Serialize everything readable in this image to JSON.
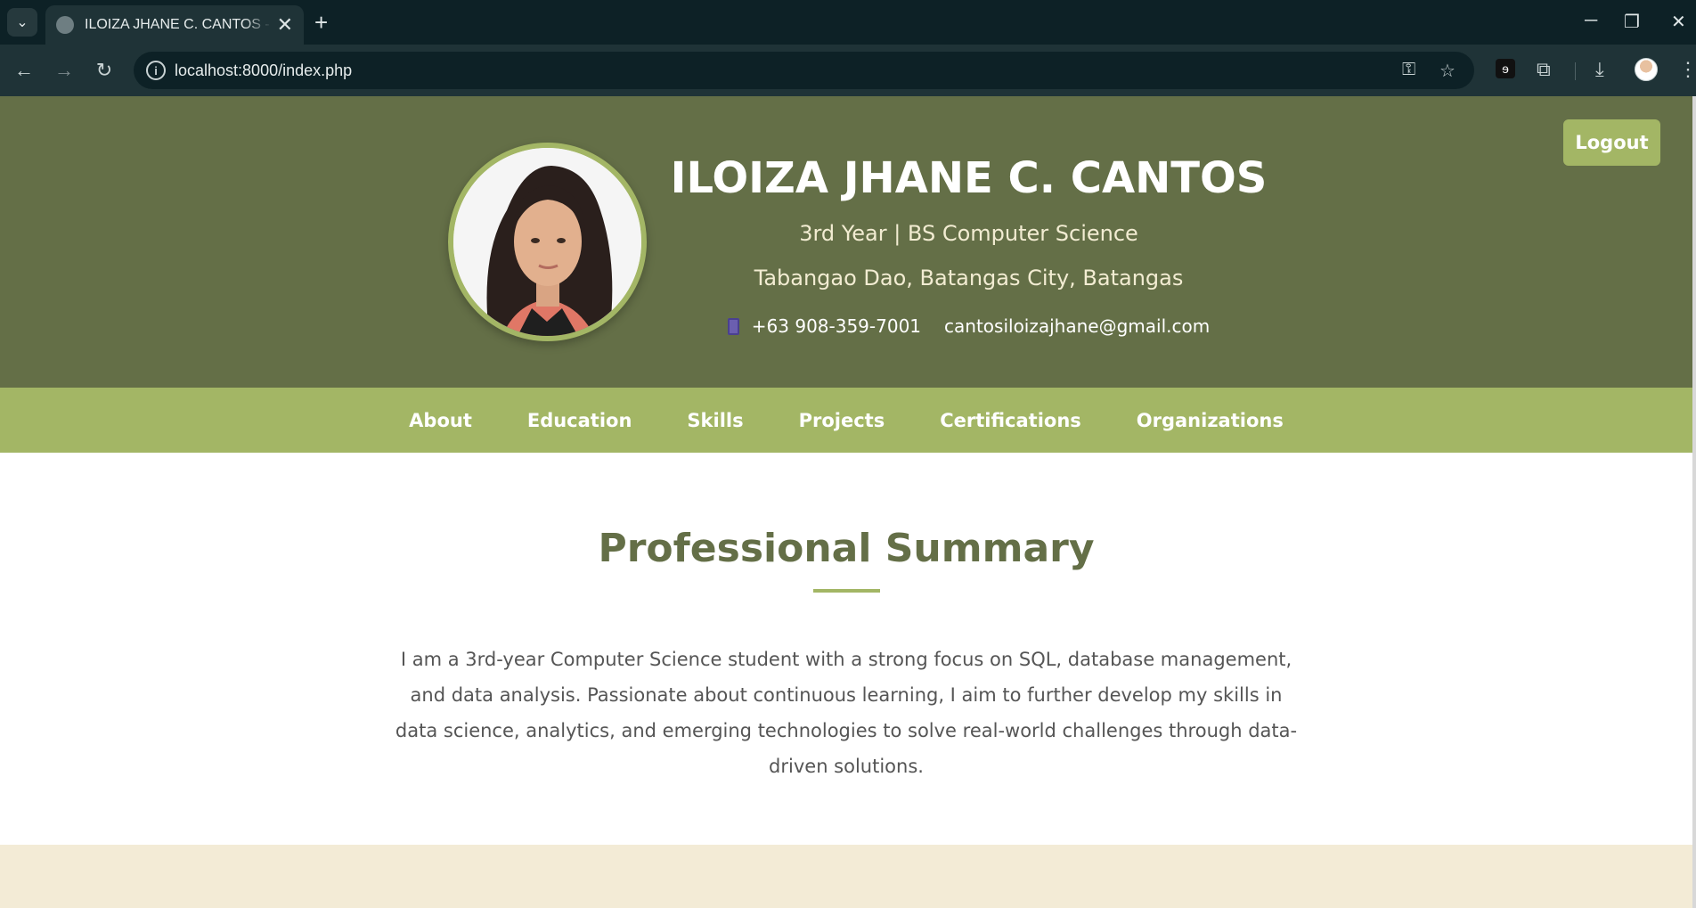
{
  "browser": {
    "tab_title": "ILOIZA JHANE C. CANTOS - Portfolio",
    "url": "localhost:8000/index.php",
    "icons": {
      "tab_search": "chevron-down-icon",
      "tab_close": "close-icon",
      "new_tab": "plus-icon",
      "back": "arrow-left-icon",
      "forward": "arrow-right-icon",
      "reload": "reload-icon",
      "site_info": "info-icon",
      "password": "key-icon",
      "bookmark": "star-icon",
      "extensions": "puzzle-icon",
      "downloads": "download-icon",
      "menu": "kebab-menu-icon"
    },
    "glyphs": {
      "tab_search": "⌄",
      "tab_close": "✕",
      "new_tab": "+",
      "minimize": "─",
      "restore": "❐",
      "close": "✕",
      "back": "←",
      "forward": "→",
      "reload": "↻",
      "site_info": "i",
      "password": "⚿",
      "bookmark": "☆",
      "extension": "ɘ",
      "extensions": "⧉",
      "downloads": "⤓",
      "menu": "⋮"
    }
  },
  "header": {
    "logout_label": "Logout",
    "name": "ILOIZA JHANE C. CANTOS",
    "subtitle": "3rd Year | BS Computer Science",
    "address": "Tabangao Dao, Batangas City, Batangas",
    "phone_icon": "phone-icon",
    "phone": "+63 908-359-7001",
    "email": "cantosiloizajhane@gmail.com"
  },
  "nav": {
    "items": [
      "About",
      "Education",
      "Skills",
      "Projects",
      "Certifications",
      "Organizations"
    ]
  },
  "summary": {
    "title": "Professional Summary",
    "text": "I am a 3rd-year Computer Science student with a strong focus on SQL, database management, and data analysis. Passionate about continuous learning, I aim to further develop my skills in data science, analytics, and emerging technologies to solve real-world challenges through data-driven solutions."
  },
  "colors": {
    "header_bg": "#646f47",
    "accent": "#a3b665",
    "next_section_bg": "#f3ebd6"
  }
}
